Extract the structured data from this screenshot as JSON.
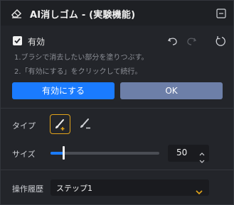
{
  "header": {
    "title": "AI消しゴム - (実験機能)"
  },
  "enable": {
    "label": "有効",
    "checked": true
  },
  "instructions": [
    "1.ブラシで消去したい部分を塗りつぶす。",
    "2.「有効にする」をクリックして続行。"
  ],
  "buttons": {
    "enable_label": "有効にする",
    "ok_label": "OK"
  },
  "type": {
    "label": "タイプ",
    "tools": [
      "brush-add-icon",
      "brush-subtract-icon"
    ],
    "selected": "brush-add-icon"
  },
  "size": {
    "label": "サイズ",
    "value": "50",
    "slider_level": 0.12
  },
  "history": {
    "label": "操作履歴",
    "selected": "ステップ1"
  },
  "colors": {
    "accent": "#1a7bff",
    "ok_button": "#6d7fa8",
    "selected_tool_border": "#e3a41a",
    "panel_bg": "#23252a"
  },
  "icons": {
    "logo": "ai-eraser-logo-icon",
    "collapse": "collapse-icon",
    "undo": "undo-icon",
    "redo": "redo-icon",
    "reset": "reset-icon"
  }
}
